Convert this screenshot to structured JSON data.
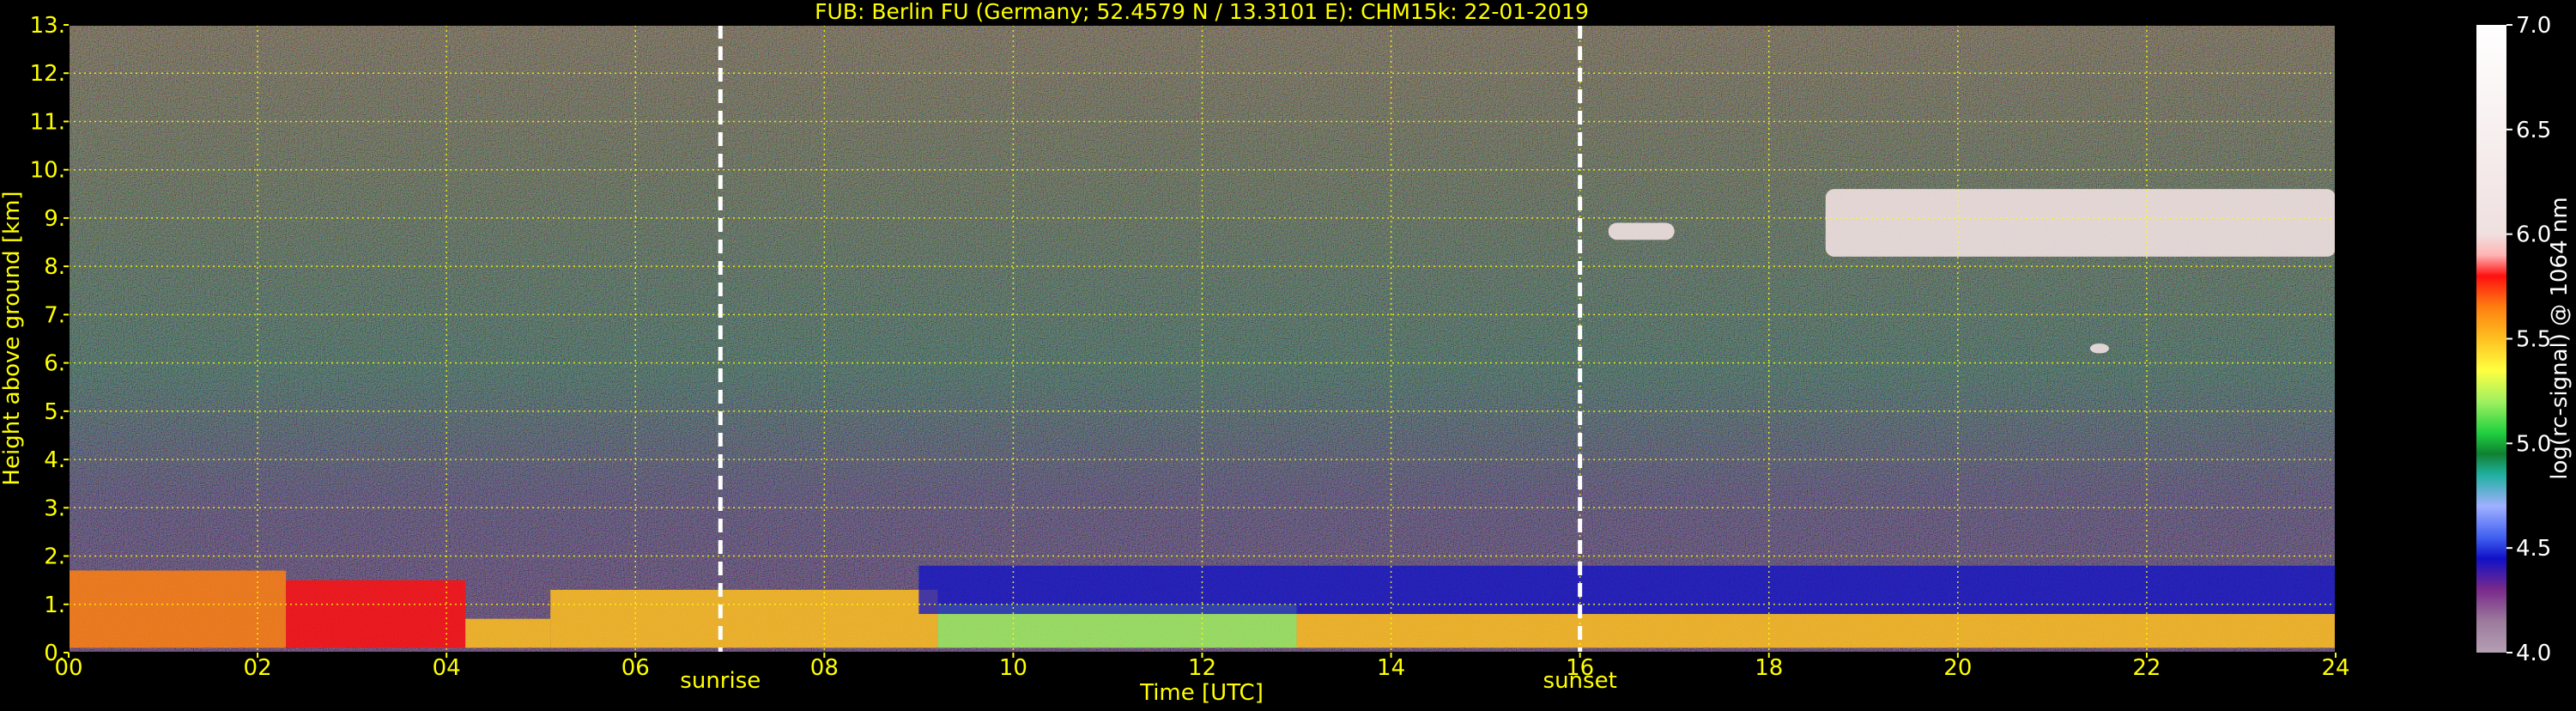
{
  "chart_data": {
    "type": "heatmap",
    "title": "FUB: Berlin FU (Germany; 52.4579 N / 13.3101 E):    CHM15k: 22-01-2019",
    "xlabel": "Time [UTC]",
    "ylabel": "Height above ground [km]",
    "xlim": [
      0,
      24
    ],
    "ylim": [
      0,
      13
    ],
    "x_ticks": [
      "00",
      "02",
      "04",
      "06",
      "08",
      "10",
      "12",
      "14",
      "16",
      "18",
      "20",
      "22",
      "24"
    ],
    "x_tick_values": [
      0,
      2,
      4,
      6,
      8,
      10,
      12,
      14,
      16,
      18,
      20,
      22,
      24
    ],
    "y_ticks": [
      "0.",
      "1.",
      "2.",
      "3.",
      "4.",
      "5.",
      "6.",
      "7.",
      "8.",
      "9.",
      "10.",
      "11.",
      "12.",
      "13."
    ],
    "y_tick_values": [
      0,
      1,
      2,
      3,
      4,
      5,
      6,
      7,
      8,
      9,
      10,
      11,
      12,
      13
    ],
    "grid": true,
    "markers": [
      {
        "label": "sunrise",
        "x": 6.9
      },
      {
        "label": "sunset",
        "x": 16.0
      }
    ],
    "colorbar": {
      "label": "log(rc-signal) @ 1064 nm",
      "range": [
        4.0,
        7.0
      ],
      "ticks": [
        "4.0",
        "4.5",
        "5.0",
        "5.5",
        "6.0",
        "6.5",
        "7.0"
      ],
      "tick_values": [
        4.0,
        4.5,
        5.0,
        5.5,
        6.0,
        6.5,
        7.0
      ],
      "stops": [
        {
          "v": 4.0,
          "c": "#b4a0b4"
        },
        {
          "v": 4.15,
          "c": "#9c7a9c"
        },
        {
          "v": 4.3,
          "c": "#7a2a8a"
        },
        {
          "v": 4.45,
          "c": "#1010c8"
        },
        {
          "v": 4.55,
          "c": "#4060f0"
        },
        {
          "v": 4.7,
          "c": "#a0b0ff"
        },
        {
          "v": 4.85,
          "c": "#20b0a0"
        },
        {
          "v": 4.95,
          "c": "#108030"
        },
        {
          "v": 5.05,
          "c": "#20d040"
        },
        {
          "v": 5.2,
          "c": "#a0f060"
        },
        {
          "v": 5.35,
          "c": "#ffff40"
        },
        {
          "v": 5.5,
          "c": "#ffc020"
        },
        {
          "v": 5.65,
          "c": "#ff8010"
        },
        {
          "v": 5.8,
          "c": "#ff1010"
        },
        {
          "v": 5.9,
          "c": "#ffb4b4"
        },
        {
          "v": 6.0,
          "c": "#f0e0e0"
        },
        {
          "v": 7.0,
          "c": "#ffffff"
        }
      ]
    },
    "features": [
      {
        "kind": "boundary-layer",
        "x": [
          0,
          2.3
        ],
        "y": [
          0.1,
          1.7
        ],
        "value": 5.7
      },
      {
        "kind": "boundary-layer",
        "x": [
          2.3,
          4.2
        ],
        "y": [
          0.1,
          1.5
        ],
        "value": 5.8
      },
      {
        "kind": "boundary-layer",
        "x": [
          4.2,
          5.1
        ],
        "y": [
          0.1,
          0.7
        ],
        "value": 5.6
      },
      {
        "kind": "boundary-layer",
        "x": [
          5.1,
          9.2
        ],
        "y": [
          0.1,
          1.3
        ],
        "value": 5.6
      },
      {
        "kind": "boundary-layer",
        "x": [
          9.2,
          13.0
        ],
        "y": [
          0.1,
          1.0
        ],
        "value": 5.3
      },
      {
        "kind": "boundary-layer",
        "x": [
          13.0,
          24.0
        ],
        "y": [
          0.1,
          0.8
        ],
        "value": 5.5
      },
      {
        "kind": "residual-layer",
        "x": [
          9.0,
          24.0
        ],
        "y": [
          0.8,
          1.8
        ],
        "value": 4.5
      },
      {
        "kind": "cloud",
        "x": [
          16.3,
          17.0
        ],
        "y": [
          8.55,
          8.9
        ],
        "value": 6.5
      },
      {
        "kind": "cloud",
        "x": [
          18.6,
          24.0
        ],
        "y": [
          8.2,
          9.6
        ],
        "value": 6.1
      },
      {
        "kind": "cloud",
        "x": [
          21.4,
          21.6
        ],
        "y": [
          6.2,
          6.4
        ],
        "value": 6.5
      }
    ]
  }
}
